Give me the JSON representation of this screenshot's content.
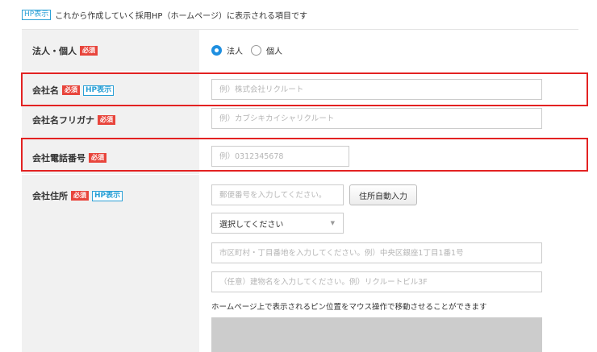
{
  "top_note": {
    "badge": "HP表示",
    "text": "これから作成していく採用HP（ホームページ）に表示される項目です"
  },
  "badges": {
    "required": "必須",
    "hp": "HP表示"
  },
  "fields": {
    "entity_type": {
      "label": "法人・個人",
      "options": [
        "法人",
        "個人"
      ],
      "selected": "法人"
    },
    "company_name": {
      "label": "会社名",
      "placeholder": "例）株式会社リクルート"
    },
    "company_kana": {
      "label": "会社名フリガナ",
      "placeholder": "例）カブシキカイシャリクルート"
    },
    "company_phone": {
      "label": "会社電話番号",
      "placeholder": "例）0312345678"
    },
    "company_address": {
      "label": "会社住所",
      "postal_placeholder": "郵便番号を入力してください。",
      "auto_button": "住所自動入力",
      "prefecture_select": "選択してください",
      "street_placeholder": "市区町村・丁目番地を入力してください。例）中央区銀座1丁目1番1号",
      "building_placeholder": "（任意）建物名を入力してください。例）リクルートビル3F",
      "map_note": "ホームページ上で表示されるピン位置をマウス操作で移動させることができます"
    }
  },
  "colors": {
    "required_badge": "#e8453c",
    "hp_badge": "#2aa0d6",
    "highlight": "#e32222",
    "radio_selected": "#1f8fe0",
    "label_column": "#f1f1f1"
  }
}
